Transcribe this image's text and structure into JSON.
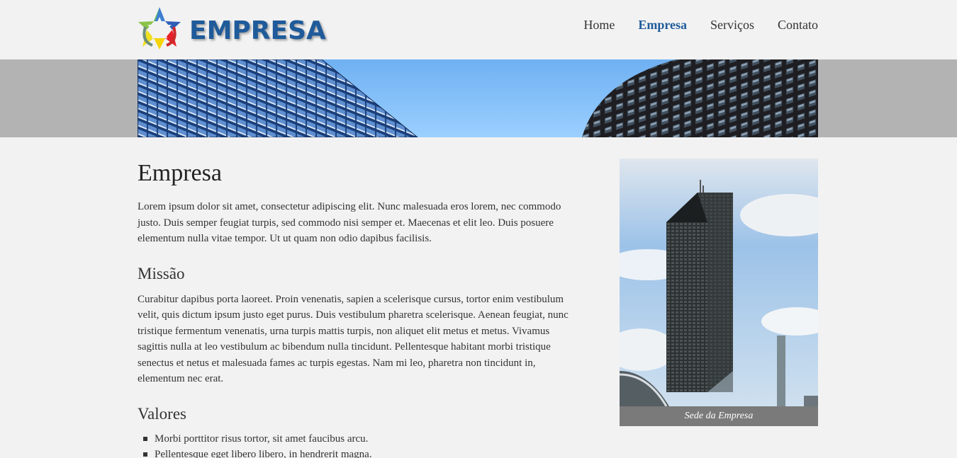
{
  "brand": {
    "name": "EMPRESA",
    "accent": "#1f5b9a",
    "logo_icon": "star-logo-icon"
  },
  "nav": {
    "items": [
      {
        "label": "Home",
        "active": false
      },
      {
        "label": "Empresa",
        "active": true
      },
      {
        "label": "Serviços",
        "active": false
      },
      {
        "label": "Contato",
        "active": false
      }
    ]
  },
  "banner": {
    "image": "office-buildings-banner"
  },
  "main": {
    "title": "Empresa",
    "intro": "Lorem ipsum dolor sit amet, consectetur adipiscing elit. Nunc malesuada eros lorem, nec commodo justo. Duis semper feugiat turpis, sed commodo nisi semper et. Maecenas et elit leo. Duis posuere elementum nulla vitae tempor. Ut ut quam non odio dapibus facilisis.",
    "mission": {
      "title": "Missão",
      "text": "Curabitur dapibus porta laoreet. Proin venenatis, sapien a scelerisque cursus, tortor enim vestibulum velit, quis dictum ipsum justo eget purus. Duis vestibulum pharetra scelerisque. Aenean feugiat, nunc tristique fermentum venenatis, urna turpis mattis turpis, non aliquet elit metus et metus. Vivamus sagittis nulla at leo vestibulum ac bibendum nulla tincidunt. Pellentesque habitant morbi tristique senectus et netus et malesuada fames ac turpis egestas. Nam mi leo, pharetra non tincidunt in, elementum nec erat."
    },
    "values": {
      "title": "Valores",
      "items": [
        "Morbi porttitor risus tortor, sit amet faucibus arcu.",
        "Pellentesque eget libero libero, in hendrerit magna."
      ]
    }
  },
  "sidebar": {
    "image": "headquarters-tower-photo",
    "caption": "Sede da Empresa"
  }
}
